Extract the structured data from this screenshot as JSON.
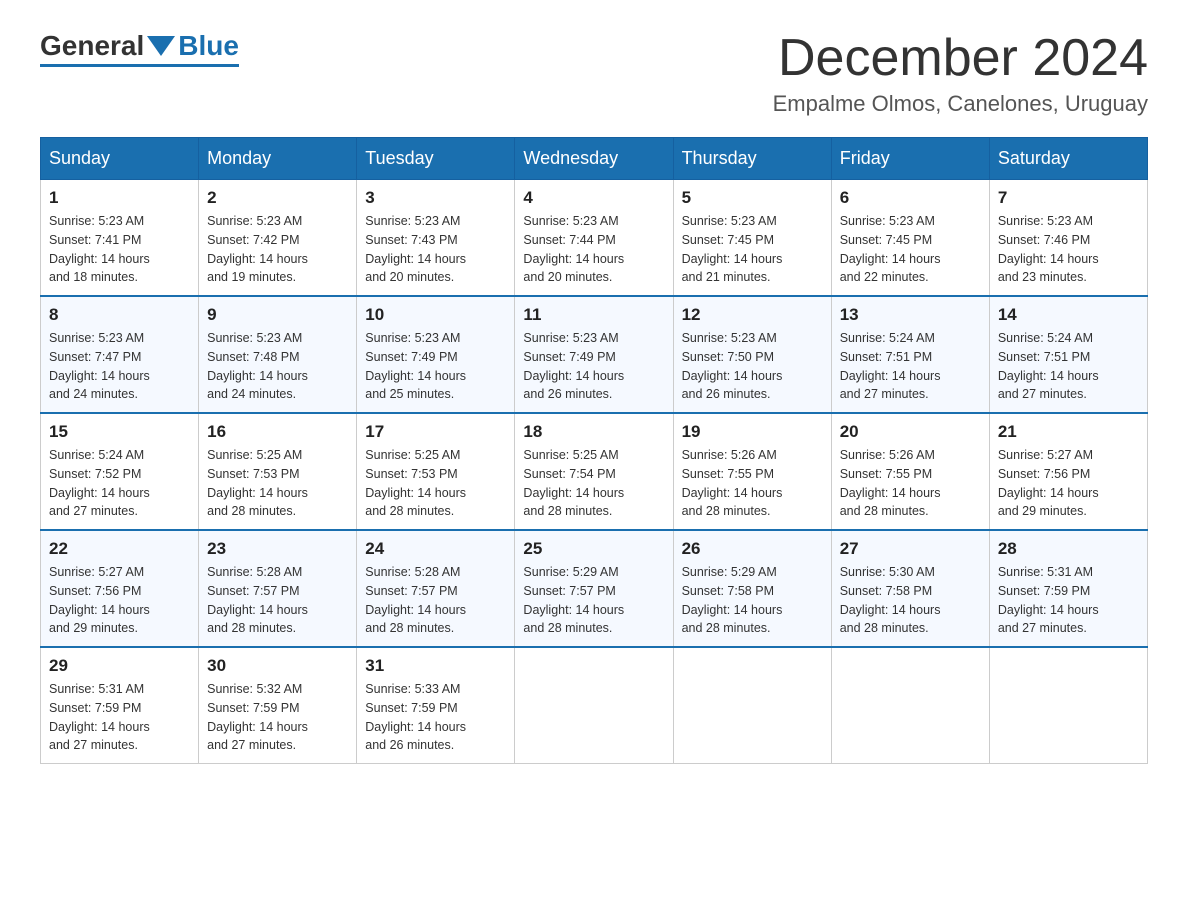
{
  "header": {
    "logo_general": "General",
    "logo_blue": "Blue",
    "month_title": "December 2024",
    "location": "Empalme Olmos, Canelones, Uruguay"
  },
  "days_of_week": [
    "Sunday",
    "Monday",
    "Tuesday",
    "Wednesday",
    "Thursday",
    "Friday",
    "Saturday"
  ],
  "weeks": [
    [
      {
        "day": "1",
        "sunrise": "5:23 AM",
        "sunset": "7:41 PM",
        "daylight": "14 hours and 18 minutes."
      },
      {
        "day": "2",
        "sunrise": "5:23 AM",
        "sunset": "7:42 PM",
        "daylight": "14 hours and 19 minutes."
      },
      {
        "day": "3",
        "sunrise": "5:23 AM",
        "sunset": "7:43 PM",
        "daylight": "14 hours and 20 minutes."
      },
      {
        "day": "4",
        "sunrise": "5:23 AM",
        "sunset": "7:44 PM",
        "daylight": "14 hours and 20 minutes."
      },
      {
        "day": "5",
        "sunrise": "5:23 AM",
        "sunset": "7:45 PM",
        "daylight": "14 hours and 21 minutes."
      },
      {
        "day": "6",
        "sunrise": "5:23 AM",
        "sunset": "7:45 PM",
        "daylight": "14 hours and 22 minutes."
      },
      {
        "day": "7",
        "sunrise": "5:23 AM",
        "sunset": "7:46 PM",
        "daylight": "14 hours and 23 minutes."
      }
    ],
    [
      {
        "day": "8",
        "sunrise": "5:23 AM",
        "sunset": "7:47 PM",
        "daylight": "14 hours and 24 minutes."
      },
      {
        "day": "9",
        "sunrise": "5:23 AM",
        "sunset": "7:48 PM",
        "daylight": "14 hours and 24 minutes."
      },
      {
        "day": "10",
        "sunrise": "5:23 AM",
        "sunset": "7:49 PM",
        "daylight": "14 hours and 25 minutes."
      },
      {
        "day": "11",
        "sunrise": "5:23 AM",
        "sunset": "7:49 PM",
        "daylight": "14 hours and 26 minutes."
      },
      {
        "day": "12",
        "sunrise": "5:23 AM",
        "sunset": "7:50 PM",
        "daylight": "14 hours and 26 minutes."
      },
      {
        "day": "13",
        "sunrise": "5:24 AM",
        "sunset": "7:51 PM",
        "daylight": "14 hours and 27 minutes."
      },
      {
        "day": "14",
        "sunrise": "5:24 AM",
        "sunset": "7:51 PM",
        "daylight": "14 hours and 27 minutes."
      }
    ],
    [
      {
        "day": "15",
        "sunrise": "5:24 AM",
        "sunset": "7:52 PM",
        "daylight": "14 hours and 27 minutes."
      },
      {
        "day": "16",
        "sunrise": "5:25 AM",
        "sunset": "7:53 PM",
        "daylight": "14 hours and 28 minutes."
      },
      {
        "day": "17",
        "sunrise": "5:25 AM",
        "sunset": "7:53 PM",
        "daylight": "14 hours and 28 minutes."
      },
      {
        "day": "18",
        "sunrise": "5:25 AM",
        "sunset": "7:54 PM",
        "daylight": "14 hours and 28 minutes."
      },
      {
        "day": "19",
        "sunrise": "5:26 AM",
        "sunset": "7:55 PM",
        "daylight": "14 hours and 28 minutes."
      },
      {
        "day": "20",
        "sunrise": "5:26 AM",
        "sunset": "7:55 PM",
        "daylight": "14 hours and 28 minutes."
      },
      {
        "day": "21",
        "sunrise": "5:27 AM",
        "sunset": "7:56 PM",
        "daylight": "14 hours and 29 minutes."
      }
    ],
    [
      {
        "day": "22",
        "sunrise": "5:27 AM",
        "sunset": "7:56 PM",
        "daylight": "14 hours and 29 minutes."
      },
      {
        "day": "23",
        "sunrise": "5:28 AM",
        "sunset": "7:57 PM",
        "daylight": "14 hours and 28 minutes."
      },
      {
        "day": "24",
        "sunrise": "5:28 AM",
        "sunset": "7:57 PM",
        "daylight": "14 hours and 28 minutes."
      },
      {
        "day": "25",
        "sunrise": "5:29 AM",
        "sunset": "7:57 PM",
        "daylight": "14 hours and 28 minutes."
      },
      {
        "day": "26",
        "sunrise": "5:29 AM",
        "sunset": "7:58 PM",
        "daylight": "14 hours and 28 minutes."
      },
      {
        "day": "27",
        "sunrise": "5:30 AM",
        "sunset": "7:58 PM",
        "daylight": "14 hours and 28 minutes."
      },
      {
        "day": "28",
        "sunrise": "5:31 AM",
        "sunset": "7:59 PM",
        "daylight": "14 hours and 27 minutes."
      }
    ],
    [
      {
        "day": "29",
        "sunrise": "5:31 AM",
        "sunset": "7:59 PM",
        "daylight": "14 hours and 27 minutes."
      },
      {
        "day": "30",
        "sunrise": "5:32 AM",
        "sunset": "7:59 PM",
        "daylight": "14 hours and 27 minutes."
      },
      {
        "day": "31",
        "sunrise": "5:33 AM",
        "sunset": "7:59 PM",
        "daylight": "14 hours and 26 minutes."
      },
      null,
      null,
      null,
      null
    ]
  ],
  "labels": {
    "sunrise": "Sunrise:",
    "sunset": "Sunset:",
    "daylight": "Daylight:"
  }
}
